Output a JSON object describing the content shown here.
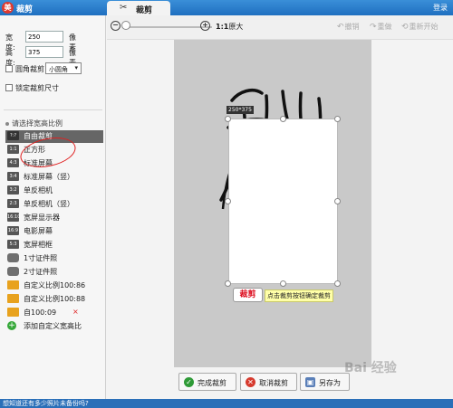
{
  "header": {
    "app_title": "裁剪",
    "logo_glyph": "美",
    "tab_label": "裁剪",
    "login": "登录"
  },
  "left": {
    "width_label": "宽度:",
    "width_value": "250",
    "height_label": "高度:",
    "height_value": "375",
    "unit": "像素",
    "rounded_label": "圆角裁剪",
    "round_select": "小圆角",
    "lock_label": "锁定裁剪尺寸",
    "ratio_heading": "请选择宽高比例",
    "ratios": [
      {
        "icon": "?:?",
        "label": "自由裁剪",
        "selected": true
      },
      {
        "icon": "1:1",
        "label": "正方形"
      },
      {
        "icon": "4:3",
        "label": "标准屏幕"
      },
      {
        "icon": "3:4",
        "label": "标准屏幕（竖）"
      },
      {
        "icon": "3:2",
        "label": "单反相机"
      },
      {
        "icon": "2:3",
        "label": "单反相机（竖）"
      },
      {
        "icon": "16:10",
        "label": "宽屏显示器"
      },
      {
        "icon": "16:9",
        "label": "电影屏幕"
      },
      {
        "icon": "5:3",
        "label": "宽屏相框"
      },
      {
        "icon": "cam",
        "label": "1寸证件照"
      },
      {
        "icon": "cam",
        "label": "2寸证件照"
      },
      {
        "icon": "folder",
        "label": "自定义比例100:86"
      },
      {
        "icon": "folder",
        "label": "自定义比例100:88"
      },
      {
        "icon": "folder",
        "label": "自100:09"
      },
      {
        "icon": "plus",
        "label": "添加自定义宽高比"
      }
    ],
    "delete_glyph": "×"
  },
  "toolbar": {
    "zoom_out": "−",
    "zoom_in": "+",
    "original_bold": "1:1",
    "original_label": "原大",
    "undo": "撤销",
    "redo": "重做",
    "restart": "重新开始"
  },
  "canvas": {
    "size_tag": "250*375",
    "crop_button": "裁剪",
    "crop_hint": "点击裁剪按钮确定裁剪"
  },
  "footer": {
    "ok": "完成裁剪",
    "cancel": "取消裁剪",
    "save": "另存为"
  },
  "status": "想知道还有多少照片未备份吗?",
  "watermark": "Bai 经验",
  "colors": {
    "title_bar": "#1f6fc0",
    "canvas_bg": "#c9c9c9",
    "accent_red": "#e02020",
    "ok_green": "#2e9a36"
  }
}
